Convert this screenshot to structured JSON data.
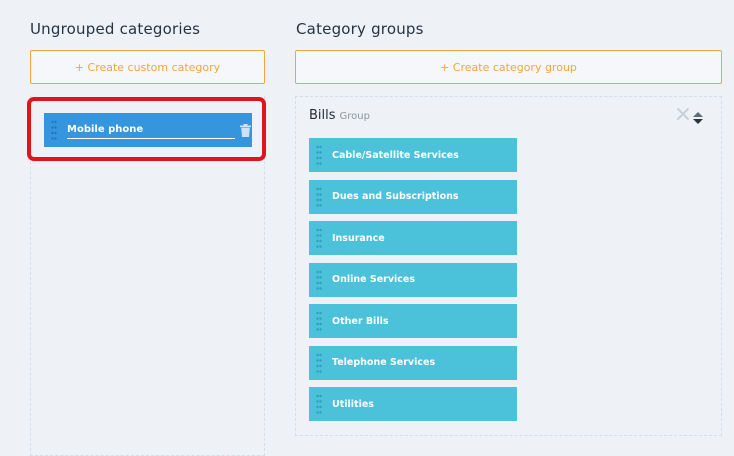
{
  "ungrouped": {
    "title": "Ungrouped categories",
    "create_button": "+ Create custom category",
    "items": [
      {
        "value": "Mobile phone",
        "selected": true
      }
    ]
  },
  "groups": {
    "title": "Category groups",
    "create_button": "+ Create category group",
    "list": [
      {
        "name": "Bills",
        "tag": "Group",
        "categories": [
          "Cable/Satellite Services",
          "Dues and Subscriptions",
          "Insurance",
          "Online Services",
          "Other Bills",
          "Telephone Services",
          "Utilities"
        ]
      }
    ]
  },
  "colors": {
    "accent_orange": "#f2a53b",
    "selected_item": "#3595dd",
    "category_item": "#4bc1da",
    "highlight_red": "#e0141b"
  },
  "icons": {
    "drag": "drag-handle-icon",
    "delete": "trash-icon",
    "close": "close-icon",
    "sort": "sort-icon"
  }
}
